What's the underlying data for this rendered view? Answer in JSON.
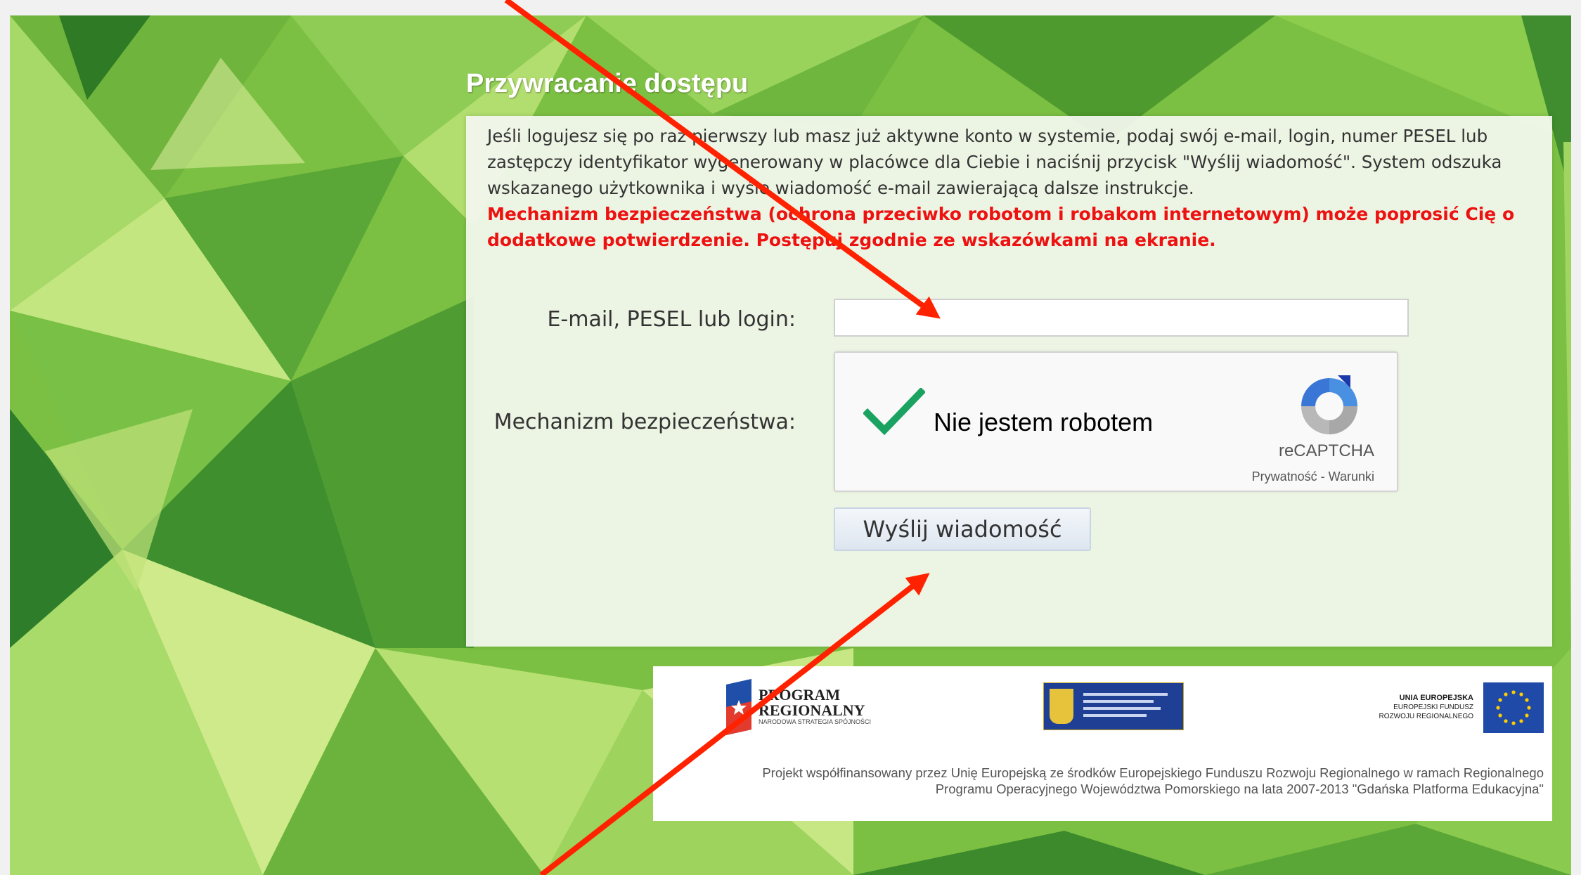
{
  "page": {
    "title": "Przywracanie dostępu",
    "intro": "Jeśli logujesz się po raz pierwszy lub masz już aktywne konto w systemie, podaj swój e-mail, login, numer PESEL lub zastępczy identyfikator wygenerowany w placówce dla Ciebie i naciśnij przycisk \"Wyślij wiadomość\". System odszuka wskazanego użytkownika i wyśle wiadomość e-mail zawierającą dalsze instrukcje.",
    "warning": "Mechanizm bezpieczeństwa (ochrona przeciwko robotom i robakom internetowym) może poprosić Cię o dodatkowe potwierdzenie. Postępuj zgodnie ze wskazówkami na ekranie."
  },
  "form": {
    "email_label": "E-mail, PESEL lub login:",
    "email_value": "",
    "security_label": "Mechanizm bezpieczeństwa:",
    "send_button": "Wyślij wiadomość"
  },
  "recaptcha": {
    "label": "Nie jestem robotem",
    "checked": true,
    "brand": "reCAPTCHA",
    "links": "Prywatność - Warunki"
  },
  "footer": {
    "program_logo_line1": "PROGRAM",
    "program_logo_line2": "REGIONALNY",
    "program_logo_sub": "NARODOWA STRATEGIA SPÓJNOŚCI",
    "eu_title": "UNIA EUROPEJSKA",
    "eu_line2": "EUROPEJSKI FUNDUSZ",
    "eu_line3": "ROZWOJU REGIONALNEGO",
    "note": "Projekt współfinansowany przez Unię Europejską ze środków Europejskiego Funduszu Rozwoju Regionalnego w ramach Regionalnego Programu Operacyjnego Województwa Pomorskiego na lata 2007-2013 \"Gdańska Platforma Edukacyjna\""
  },
  "colors": {
    "warning": "#ee1111",
    "arrow": "#ff2200",
    "check": "#1aa260",
    "background_green": "#7cc043"
  },
  "icons": [
    "checkmark-icon",
    "recaptcha-logo-icon",
    "program-regionalny-flag-icon",
    "eu-flag-icon",
    "pomorskie-crest-icon"
  ]
}
